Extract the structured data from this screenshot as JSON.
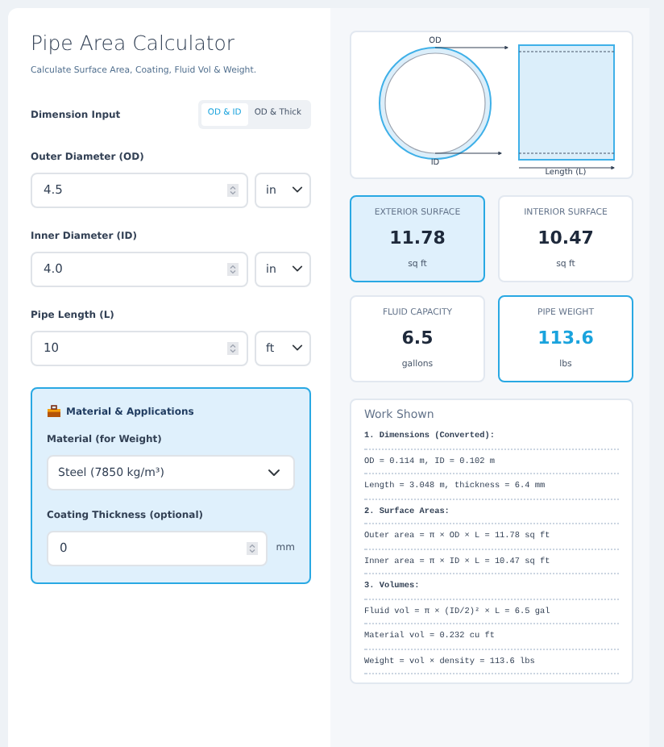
{
  "title": "Pipe Area Calculator",
  "subtitle": "Calculate Surface Area, Coating, Fluid Vol & Weight.",
  "dimension_input": {
    "label": "Dimension Input",
    "options": [
      {
        "label": "OD & ID",
        "selected": true
      },
      {
        "label": "OD & Thick",
        "selected": false
      }
    ]
  },
  "fields": [
    {
      "label": "Outer Diameter (OD)",
      "value": "4.5",
      "unit": "in"
    },
    {
      "label": "Inner Diameter (ID)",
      "value": "4.0",
      "unit": "in"
    },
    {
      "label": "Pipe Length (L)",
      "value": "10",
      "unit": "ft"
    }
  ],
  "material_section": {
    "title": "Material & Applications",
    "material": {
      "label": "Material (for Weight)",
      "value": "Steel (7850 kg/m³)"
    },
    "coating": {
      "label": "Coating Thickness (optional)",
      "value": "0",
      "unit": "mm"
    }
  },
  "diagram": {
    "od_label": "OD",
    "id_label": "ID",
    "length_label": "Length (L)"
  },
  "results": [
    {
      "label": "EXTERIOR SURFACE",
      "value": "11.78",
      "unit": "sq ft",
      "kind": "filled"
    },
    {
      "label": "INTERIOR SURFACE",
      "value": "10.47",
      "unit": "sq ft",
      "kind": "plain"
    },
    {
      "label": "FLUID CAPACITY",
      "value": "6.5",
      "unit": "gallons",
      "kind": "plain"
    },
    {
      "label": "PIPE WEIGHT",
      "value": "113.6",
      "unit": "lbs",
      "kind": "outlined"
    }
  ],
  "work_shown": {
    "title": "Work Shown",
    "lines": [
      {
        "text": "1. Dimensions (Converted):",
        "kind": "heading"
      },
      {
        "text": "OD = 0.114 m, ID = 0.102 m",
        "kind": "line"
      },
      {
        "text": "Length = 3.048 m, thickness = 6.4 mm",
        "kind": "line"
      },
      {
        "text": "2. Surface Areas:",
        "kind": "heading"
      },
      {
        "text": "Outer area = π × OD × L = 11.78 sq ft",
        "kind": "line"
      },
      {
        "text": "Inner area = π × ID × L = 10.47 sq ft",
        "kind": "line"
      },
      {
        "text": "3. Volumes:",
        "kind": "heading"
      },
      {
        "text": "Fluid vol = π × (ID/2)² × L = 6.5 gal",
        "kind": "line"
      },
      {
        "text": "Material vol = 0.232 cu ft",
        "kind": "line"
      },
      {
        "text": "Weight = vol × density = 113.6 lbs",
        "kind": "line"
      }
    ]
  }
}
